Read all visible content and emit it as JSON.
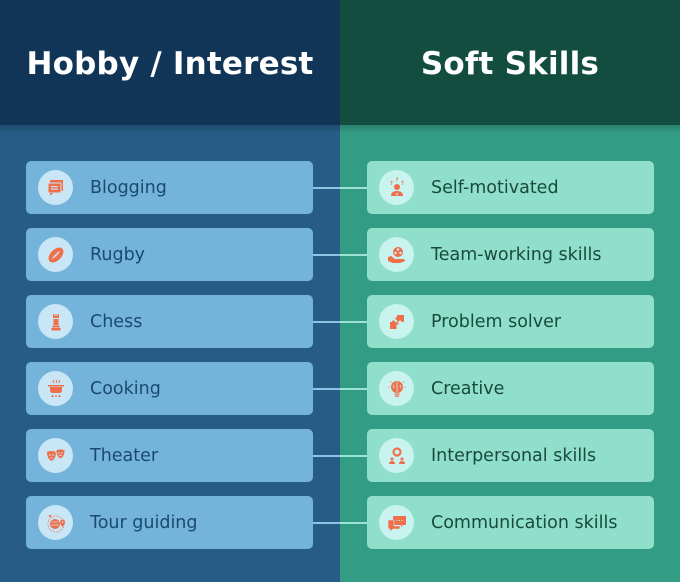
{
  "left_column": {
    "title": "Hobby / Interest",
    "color_header": "#113557",
    "color_bg": "#265c86",
    "items": [
      {
        "label": "Blogging",
        "icon": "blog-icon"
      },
      {
        "label": "Rugby",
        "icon": "rugby-ball-icon"
      },
      {
        "label": "Chess",
        "icon": "chess-rook-icon"
      },
      {
        "label": "Cooking",
        "icon": "cooking-pot-icon"
      },
      {
        "label": "Theater",
        "icon": "theater-masks-icon"
      },
      {
        "label": "Tour guiding",
        "icon": "globe-pin-icon"
      }
    ]
  },
  "right_column": {
    "title": "Soft Skills",
    "color_header": "#134d3f",
    "color_bg": "#339c85",
    "items": [
      {
        "label": "Self-motivated",
        "icon": "person-question-icon"
      },
      {
        "label": "Team-working skills",
        "icon": "team-hand-icon"
      },
      {
        "label": "Problem solver",
        "icon": "puzzle-icon"
      },
      {
        "label": "Creative",
        "icon": "brain-bulb-icon"
      },
      {
        "label": "Interpersonal skills",
        "icon": "people-network-icon"
      },
      {
        "label": "Communication skills",
        "icon": "chat-bubbles-icon"
      }
    ]
  },
  "icon_color": "#ef6f4a"
}
